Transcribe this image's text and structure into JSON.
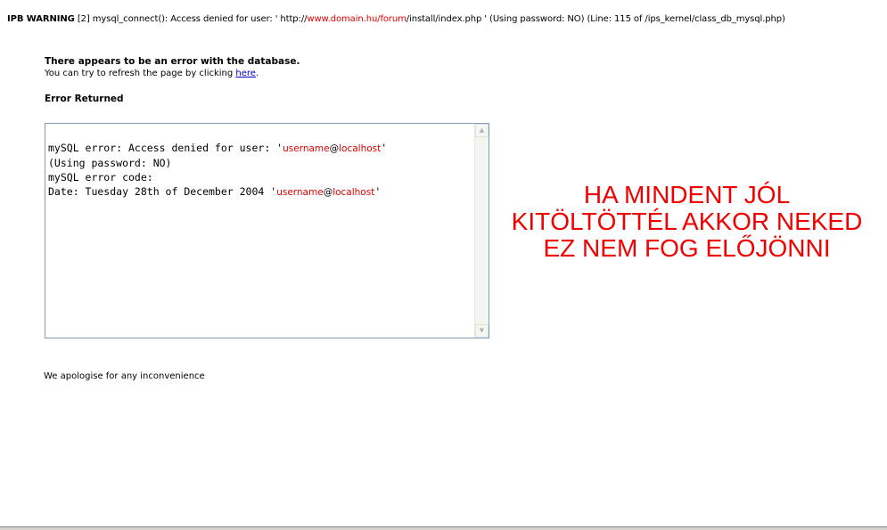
{
  "warning": {
    "label": "IPB WARNING",
    "text1": " [2] mysql_connect(): Access denied for user: ' http://",
    "domain": "www.domain.hu/forum",
    "text2": "/install/index.php ' (Using password: NO) (Line: 115 of /ips_kernel/class_db_mysql.php)"
  },
  "main": {
    "heading": "There appears to be an error with the database.",
    "refresh_text": "You can try to refresh the page by clicking ",
    "refresh_link": "here",
    "refresh_end": ".",
    "error_returned": "Error Returned",
    "error_lines": {
      "l1_prefix": "mySQL error: Access denied for user: '",
      "l1_user": "username",
      "l1_at": "@",
      "l1_host": "localhost",
      "l1_suffix": "'",
      "l2": "(Using password: NO)",
      "l3": "mySQL error code:",
      "l4_prefix": "Date: Tuesday 28th of December 2004 '",
      "l4_user": "username",
      "l4_at": "@",
      "l4_host": "localhost",
      "l4_suffix": "'"
    },
    "apology": "We apologise for any inconvenience"
  },
  "overlay": {
    "line1": "HA MINDENT JÓL",
    "line2": "KITÖLTÖTTÉL AKKOR NEKED",
    "line3": "EZ NEM FOG ELŐJÖNNI"
  },
  "scrollbar": {
    "up_icon": "▲",
    "down_icon": "▼"
  },
  "colors": {
    "highlight": "#e00000",
    "link": "#0000cc",
    "overlay": "#f00000"
  }
}
